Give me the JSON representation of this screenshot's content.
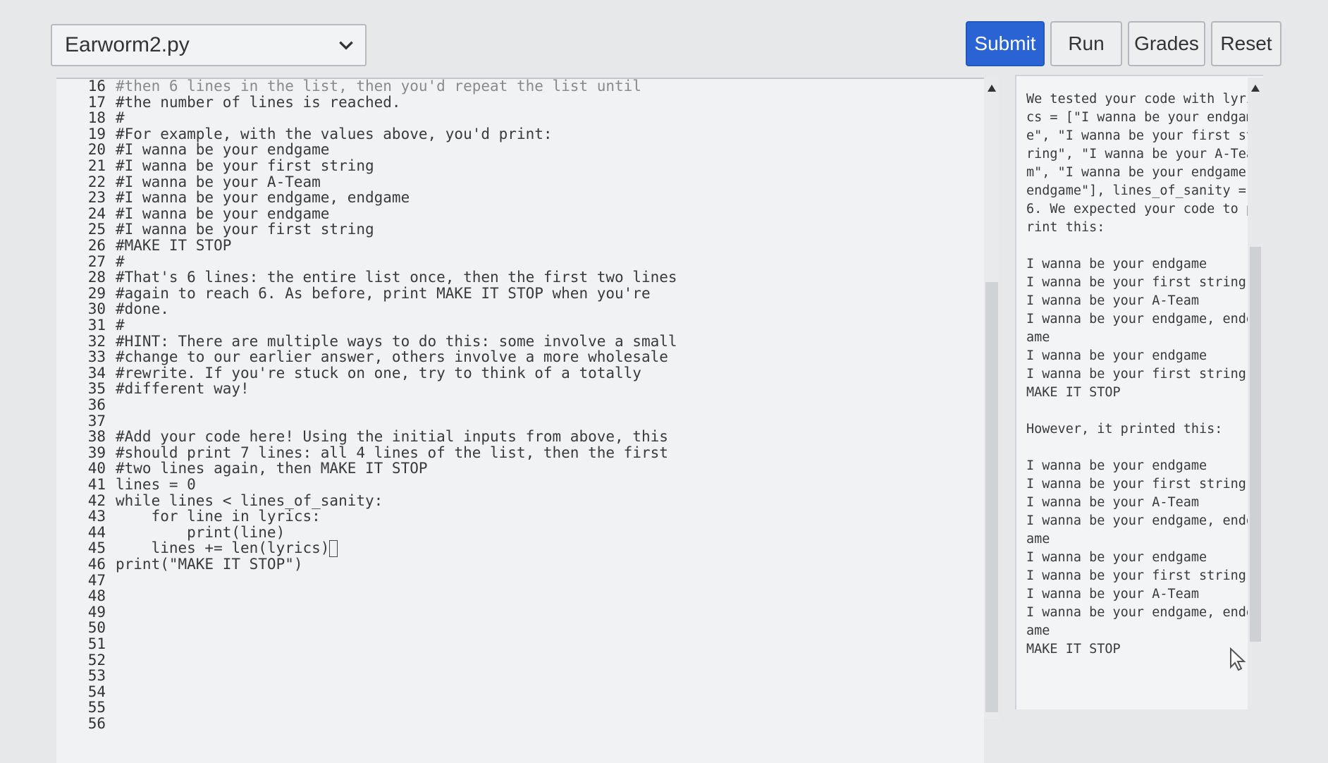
{
  "header": {
    "file_name": "Earworm2.py",
    "buttons": {
      "submit": "Submit",
      "run": "Run",
      "grades": "Grades",
      "reset": "Reset"
    }
  },
  "colors": {
    "primary": "#2a63d4",
    "background": "#e6e8e9"
  },
  "editor": {
    "lines": [
      {
        "num": "16",
        "text": "#then 6 lines in the list, then you'd repeat the list until"
      },
      {
        "num": "17",
        "text": "#the number of lines is reached."
      },
      {
        "num": "18",
        "text": "#"
      },
      {
        "num": "19",
        "text": "#For example, with the values above, you'd print:"
      },
      {
        "num": "20",
        "text": "#I wanna be your endgame"
      },
      {
        "num": "21",
        "text": "#I wanna be your first string"
      },
      {
        "num": "22",
        "text": "#I wanna be your A-Team"
      },
      {
        "num": "23",
        "text": "#I wanna be your endgame, endgame"
      },
      {
        "num": "24",
        "text": "#I wanna be your endgame"
      },
      {
        "num": "25",
        "text": "#I wanna be your first string"
      },
      {
        "num": "26",
        "text": "#MAKE IT STOP"
      },
      {
        "num": "27",
        "text": "#"
      },
      {
        "num": "28",
        "text": "#That's 6 lines: the entire list once, then the first two lines"
      },
      {
        "num": "29",
        "text": "#again to reach 6. As before, print MAKE IT STOP when you're"
      },
      {
        "num": "30",
        "text": "#done."
      },
      {
        "num": "31",
        "text": "#"
      },
      {
        "num": "32",
        "text": "#HINT: There are multiple ways to do this: some involve a small"
      },
      {
        "num": "33",
        "text": "#change to our earlier answer, others involve a more wholesale"
      },
      {
        "num": "34",
        "text": "#rewrite. If you're stuck on one, try to think of a totally"
      },
      {
        "num": "35",
        "text": "#different way!"
      },
      {
        "num": "36",
        "text": ""
      },
      {
        "num": "37",
        "text": ""
      },
      {
        "num": "38",
        "text": "#Add your code here! Using the initial inputs from above, this"
      },
      {
        "num": "39",
        "text": "#should print 7 lines: all 4 lines of the list, then the first"
      },
      {
        "num": "40",
        "text": "#two lines again, then MAKE IT STOP"
      },
      {
        "num": "41",
        "text": "lines = 0"
      },
      {
        "num": "42",
        "text": "while lines < lines_of_sanity:"
      },
      {
        "num": "43",
        "text": "    for line in lyrics:"
      },
      {
        "num": "44",
        "text": "        print(line)"
      },
      {
        "num": "45",
        "text": "    lines += len(lyrics)"
      },
      {
        "num": "46",
        "text": "print(\"MAKE IT STOP\")"
      },
      {
        "num": "47",
        "text": ""
      },
      {
        "num": "48",
        "text": ""
      },
      {
        "num": "49",
        "text": ""
      },
      {
        "num": "50",
        "text": ""
      },
      {
        "num": "51",
        "text": ""
      },
      {
        "num": "52",
        "text": ""
      },
      {
        "num": "53",
        "text": ""
      },
      {
        "num": "54",
        "text": ""
      },
      {
        "num": "55",
        "text": ""
      },
      {
        "num": "56",
        "text": ""
      }
    ]
  },
  "output": {
    "text": "We tested your code with lyrics = [\"I wanna be your endgame\", \"I wanna be your first string\", \"I wanna be your A-Team\", \"I wanna be your endgame, endgame\"], lines_of_sanity = 6. We expected your code to print this:\n\nI wanna be your endgame\nI wanna be your first string\nI wanna be your A-Team\nI wanna be your endgame, endgame\nI wanna be your endgame\nI wanna be your first string\nMAKE IT STOP\n\nHowever, it printed this:\n\nI wanna be your endgame\nI wanna be your first string\nI wanna be your A-Team\nI wanna be your endgame, endgame\nI wanna be your endgame\nI wanna be your first string\nI wanna be your A-Team\nI wanna be your endgame, endgame\nMAKE IT STOP"
  }
}
